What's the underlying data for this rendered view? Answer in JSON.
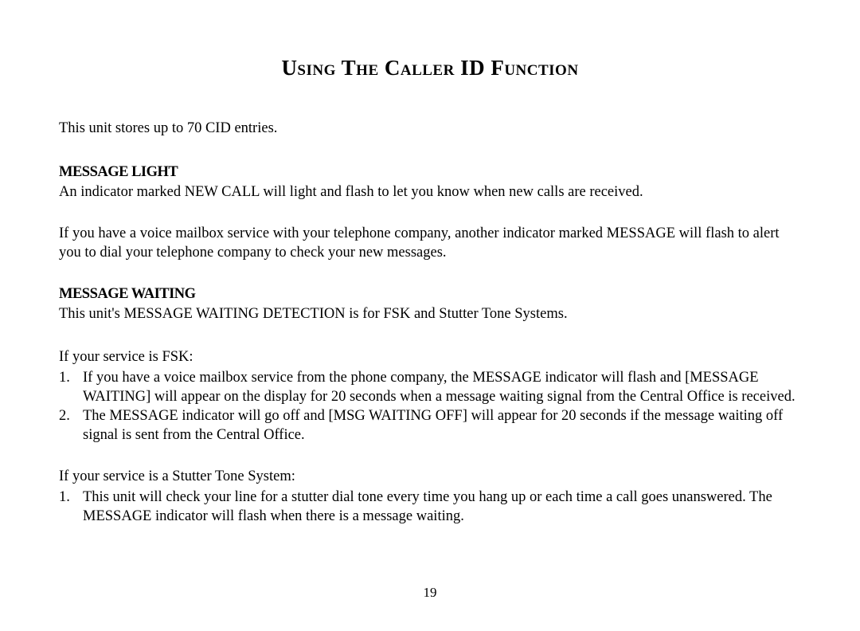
{
  "title": "Using The Caller ID Function",
  "intro": "This unit stores up to 70 CID entries.",
  "section1": {
    "heading": "MESSAGE LIGHT",
    "para1": "An indicator marked NEW CALL will light and flash to let you know when new calls are received.",
    "para2": "If you have a voice mailbox service with your telephone company, another indicator marked MESSAGE will flash to alert you to dial your telephone company to check your new messages."
  },
  "section2": {
    "heading": "MESSAGE WAITING",
    "para1": "This unit's MESSAGE WAITING DETECTION is for FSK and Stutter Tone Systems.",
    "fsk_intro": "If your service is FSK:",
    "fsk_items": [
      {
        "num": "1.",
        "text": "If you have a voice mailbox service from the phone company, the MESSAGE indicator will flash and [MESSAGE WAITING] will appear on the display for 20 seconds when a message waiting signal from the Central Office is received."
      },
      {
        "num": "2.",
        "text": "The MESSAGE indicator will go off and [MSG WAITING OFF] will appear for 20 seconds if the message waiting off signal is sent from the Central Office."
      }
    ],
    "stutter_intro": "If your service is a Stutter Tone System:",
    "stutter_items": [
      {
        "num": "1.",
        "text": "This unit will check your line for a stutter dial tone every time you hang up or each time a call goes unanswered. The MESSAGE indicator will flash when there is a message waiting."
      }
    ]
  },
  "page_number": "19"
}
